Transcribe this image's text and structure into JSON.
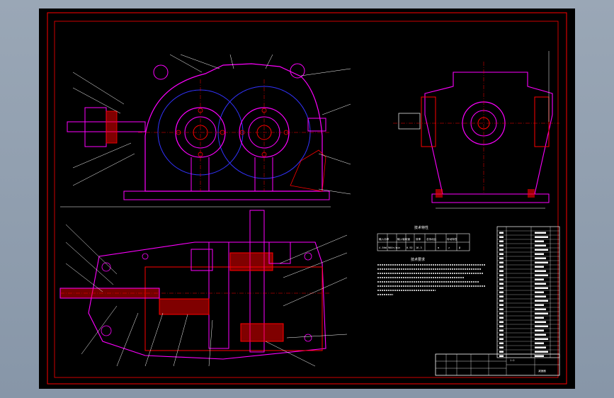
{
  "drawing": {
    "frame_color": "#ff0000",
    "part_color": "#ff00ff",
    "section_color": "#ff0000",
    "hidden_color": "#0000ff",
    "leader_color": "#ffffff",
    "fill_color": "#000000"
  },
  "notes": {
    "table_title": "技术特性",
    "requirements_title": "技术要求",
    "table_headers": [
      "输入功率",
      "输入轴转速",
      "效率",
      "总传动比",
      "传动特性"
    ],
    "table_values": [
      "4.5kW",
      "960r/min",
      "0.92",
      "16.3",
      "m",
      "z",
      "β"
    ]
  },
  "title_block": {
    "scale": "1:2",
    "label": "减速器"
  }
}
